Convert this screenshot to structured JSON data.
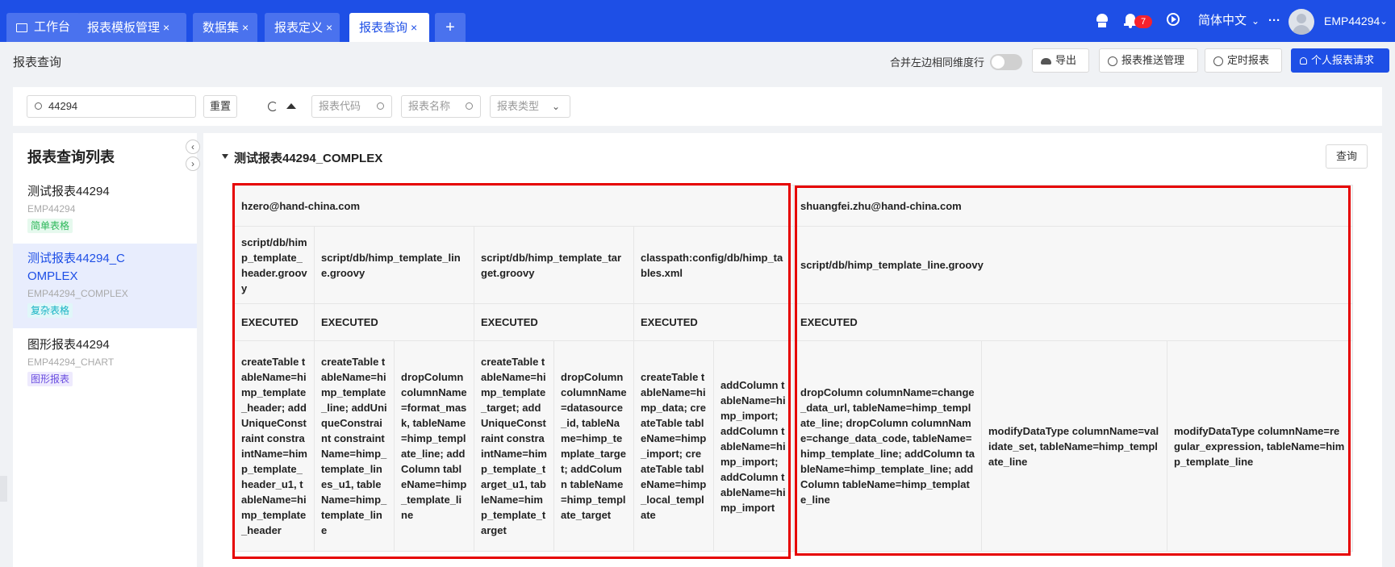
{
  "topbar": {
    "tabs": [
      {
        "label": "工作台"
      },
      {
        "label": "报表模板管理"
      },
      {
        "label": "数据集"
      },
      {
        "label": "报表定义"
      },
      {
        "label": "报表查询"
      }
    ],
    "close_glyph": "×",
    "add_glyph": "+",
    "notification_count": "7",
    "language": "简体中文",
    "more_glyph": "···",
    "username": "EMP44294"
  },
  "page": {
    "title": "报表查询",
    "merge_label": "合并左边相同维度行",
    "export_label": "导出",
    "push_label": "报表推送管理",
    "timer_label": "定时报表",
    "personal_label": "个人报表请求"
  },
  "filter": {
    "search_value": "44294",
    "reset_label": "重置",
    "code_placeholder": "报表代码",
    "name_placeholder": "报表名称",
    "type_placeholder": "报表类型"
  },
  "sidebar": {
    "title": "报表查询列表",
    "items": [
      {
        "name": "测试报表44294",
        "code": "EMP44294",
        "tag": "简单表格"
      },
      {
        "name_line1": "测试报表44294_C",
        "name_line2": "OMPLEX",
        "code": "EMP44294_COMPLEX",
        "tag": "复杂表格"
      },
      {
        "name": "图形报表44294",
        "code": "EMP44294_CHART",
        "tag": "图形报表"
      }
    ]
  },
  "report": {
    "title": "测试报表44294_COMPLEX",
    "query_label": "查询",
    "authors": [
      "hzero@hand-china.com",
      "shuangfei.zhu@hand-china.com"
    ],
    "files": [
      "script/db/himp_template_header.groovy",
      "script/db/himp_template_line.groovy",
      "script/db/himp_template_target.groovy",
      "classpath:config/db/himp_tables.xml",
      "script/db/himp_template_line.groovy"
    ],
    "status": "EXECUTED",
    "changes": [
      "createTable tableName=himp_template_header; addUniqueConstraint constraintName=himp_template_header_u1, tableName=himp_template_header",
      "createTable tableName=himp_template_line; addUniqueConstraint constraintName=himp_template_lines_u1, tableName=himp_template_line",
      "dropColumn columnName=format_mask, tableName=himp_template_line; addColumn tableName=himp_template_line",
      "createTable tableName=himp_template_target; addUniqueConstraint constraintName=himp_template_target_u1, tableName=himp_template_target",
      "dropColumn columnName=datasource_id, tableName=himp_template_target; addColumn tableName=himp_template_target",
      "createTable tableName=himp_data; createTable tableName=himp_import; createTable tableName=himp_local_template",
      "addColumn tableName=himp_import; addColumn tableName=himp_import; addColumn tableName=himp_import",
      "dropColumn columnName=change_data_url, tableName=himp_template_line; dropColumn columnName=change_data_code, tableName=himp_template_line; addColumn tableName=himp_template_line; addColumn tableName=himp_template_line",
      "modifyDataType columnName=validate_set, tableName=himp_template_line",
      "modifyDataType columnName=regular_expression, tableName=himp_template_line"
    ]
  },
  "colors": {
    "brand": "#1e4fe6",
    "highlight": "#e60000"
  }
}
